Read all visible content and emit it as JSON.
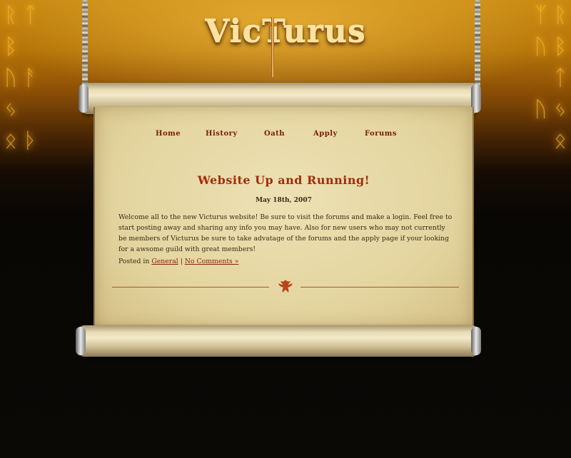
{
  "brand": {
    "logo_text": "VicTurus"
  },
  "nav": {
    "items": [
      "Home",
      "History",
      "Oath",
      "Apply",
      "Forums"
    ]
  },
  "post": {
    "title": "Website Up and Running!",
    "date": "May 18th, 2007",
    "body": "Welcome all to the new Victurus website! Be sure to visit the forums and make a login. Feel free to start posting away and sharing any info you may have. Also for new users who may not currently be members of Victurus be sure to take advatage of the forums and the apply page if your looking for a awsome guild with great members!",
    "meta": {
      "posted_in_label": "Posted in",
      "category": "General",
      "separator": "|",
      "comments": "No Comments »"
    }
  },
  "colors": {
    "accent_red": "#a32b09",
    "nav_text": "#7a1c08",
    "parchment": "#e4d5a0",
    "glow_gold": "#ffb320"
  },
  "icons": [
    "sword-icon",
    "phoenix-icon",
    "rune-glyphs"
  ]
}
